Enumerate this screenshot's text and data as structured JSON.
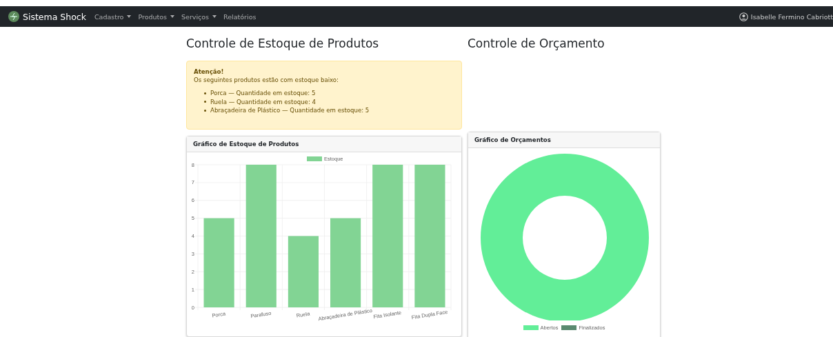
{
  "navbar": {
    "brand": "Sistema Shock",
    "menu": [
      {
        "label": "Cadastro",
        "dropdown": true
      },
      {
        "label": "Produtos",
        "dropdown": true
      },
      {
        "label": "Serviços",
        "dropdown": true
      },
      {
        "label": "Relatórios",
        "dropdown": false
      }
    ],
    "user": "Isabelle Fermino Cabriott"
  },
  "stock": {
    "title": "Controle de Estoque de Produtos",
    "alert": {
      "heading": "Atenção!",
      "message": "Os seguintes produtos estão com estoque baixo:",
      "items": [
        "Porca — Quantidade em estoque: 5",
        "Ruela — Quantidade em estoque: 4",
        "Abraçadeira de Plástico — Quantidade em estoque: 5"
      ]
    },
    "card": {
      "title": "Gráfico de Estoque de Produtos",
      "chart_data": {
        "type": "bar",
        "categories": [
          "Porca",
          "Parafuso",
          "Ruela",
          "Abraçadeira de Plástico",
          "Fita Isolante",
          "Fita Dupla Face"
        ],
        "series": [
          {
            "name": "Estoque",
            "color": "#82d494",
            "values": [
              5,
              8,
              4,
              5,
              8,
              8
            ]
          }
        ],
        "ylim": [
          0,
          8
        ],
        "grid": true,
        "yticks": [
          0,
          1,
          2,
          3,
          4,
          5,
          6,
          7,
          8
        ]
      }
    }
  },
  "budget": {
    "title": "Controle de Orçamento",
    "card": {
      "title": "Gráfico de Orçamentos",
      "legend": [
        {
          "label": "Abertos",
          "color": "#62ee98"
        },
        {
          "label": "Finalizados",
          "color": "#5a8a70"
        }
      ]
    }
  }
}
